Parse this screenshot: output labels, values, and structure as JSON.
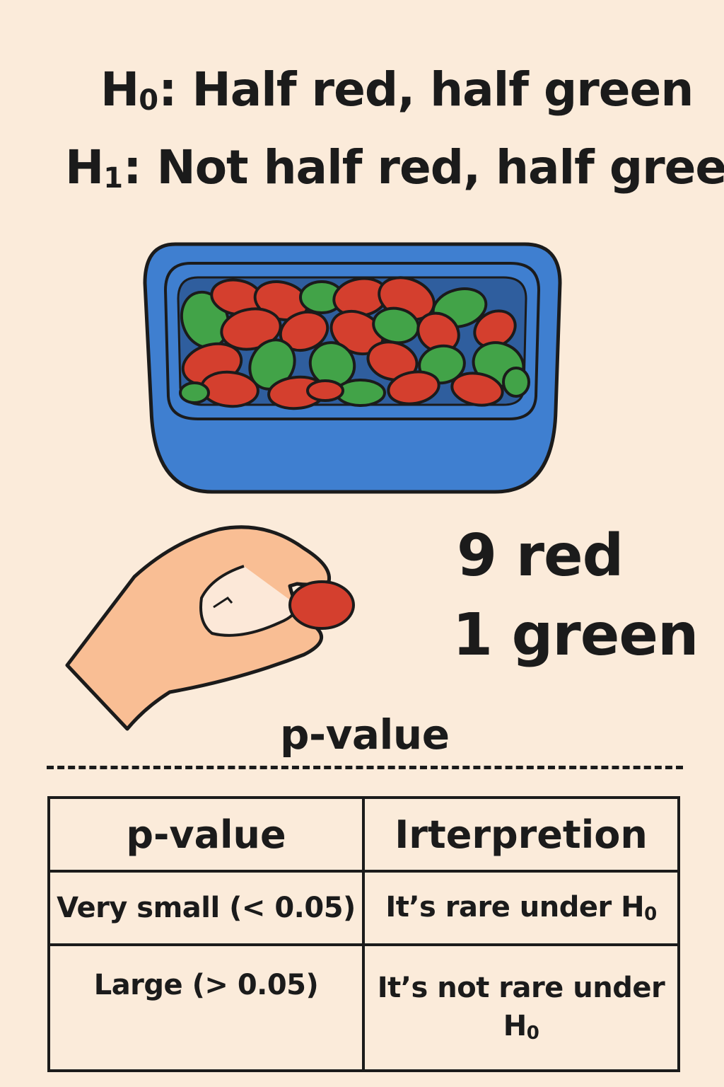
{
  "hypotheses": {
    "h0": {
      "symbol": "H",
      "subscript": "0",
      "text": "Half red, half green"
    },
    "h1": {
      "symbol": "H",
      "subscript": "1",
      "text": "Not half red, half green"
    }
  },
  "result": {
    "red_line": "9 red",
    "green_line": "1 green"
  },
  "p_value_caption": "p-value",
  "table": {
    "headers": [
      "p-value",
      "Irterpretion"
    ],
    "rows": [
      {
        "p": "Very small (< 0.05)",
        "interp_text": "It’s rare under H",
        "interp_sub": "0"
      },
      {
        "p": "Large (> 0.05)",
        "interp_text": "It’s not rare under H",
        "interp_sub": "0"
      }
    ]
  },
  "colors": {
    "background": "#fbebda",
    "bowl": "#3f7fd0",
    "red_bean": "#d43f2e",
    "green_bean": "#42a348",
    "skin": "#f9be94",
    "outline": "#1b1b1b"
  }
}
